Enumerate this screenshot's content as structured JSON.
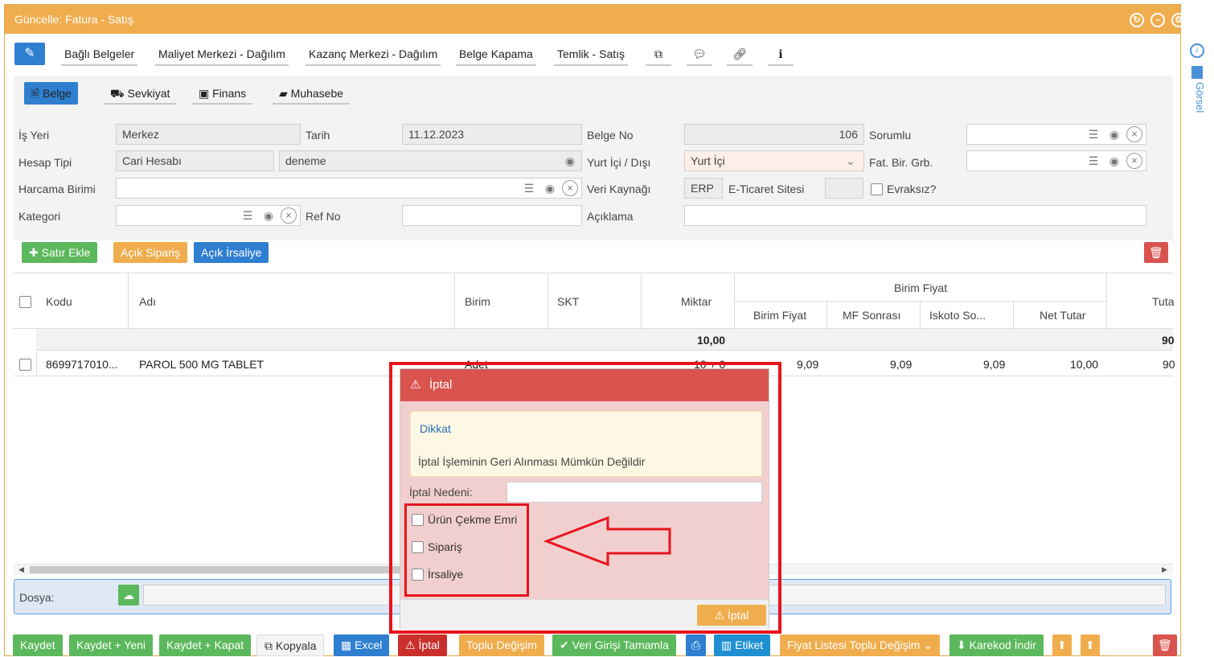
{
  "window": {
    "title": "Güncelle: Fatura - Satış"
  },
  "toolbar": {
    "items": [
      "Bağlı Belgeler",
      "Maliyet Merkezi - Dağılım",
      "Kazanç Merkezi - Dağılım",
      "Belge Kapama",
      "Temlik - Satış"
    ],
    "icons": [
      "edit-icon",
      "copy-icon",
      "comment-icon",
      "link-icon",
      "info-icon"
    ]
  },
  "tabs": [
    {
      "label": "Belge",
      "active": true,
      "icon": "document-icon"
    },
    {
      "label": "Sevkiyat",
      "icon": "truck-icon"
    },
    {
      "label": "Finans",
      "icon": "money-icon"
    },
    {
      "label": "Muhasebe",
      "icon": "book-icon"
    }
  ],
  "form": {
    "is_yeri_label": "İş Yeri",
    "is_yeri_value": "Merkez",
    "tarih_label": "Tarih",
    "tarih_value": "11.12.2023",
    "belge_no_label": "Belge No",
    "belge_no_value": "106",
    "sorumlu_label": "Sorumlu",
    "hesap_tipi_label": "Hesap Tipi",
    "hesap_tipi_value": "Cari Hesabı",
    "hesap_value": "deneme",
    "yurt_label": "Yurt İçi / Dışı",
    "yurt_value": "Yurt İçi",
    "fat_label": "Fat. Bir. Grb.",
    "harcama_label": "Harcama Birimi",
    "veri_kaynagi_label": "Veri Kaynağı",
    "veri_kaynagi_value": "ERP",
    "eticaret_label": "E-Ticaret Sitesi",
    "evraksiz_label": "Evraksız?",
    "kategori_label": "Kategori",
    "ref_no_label": "Ref No",
    "aciklama_label": "Açıklama"
  },
  "grid_actions": {
    "add_row": "Satır Ekle",
    "open_order": "Açık Sipariş",
    "open_waybill": "Açık İrsaliye"
  },
  "grid": {
    "headers": {
      "kodu": "Kodu",
      "adi": "Adı",
      "birim": "Birim",
      "skt": "SKT",
      "miktar": "Miktar",
      "birim_fiyat_group": "Birim Fiyat",
      "birim_fiyat": "Birim Fiyat",
      "mf_sonrasi": "MF Sonrası",
      "iskoto": "Iskoto So...",
      "net_tutar": "Net Tutar",
      "tutar": "Tuta"
    },
    "summary": {
      "miktar": "10,00",
      "tutar": "90"
    },
    "rows": [
      {
        "kodu": "8699717010...",
        "adi": "PAROL 500 MG TABLET",
        "birim": "Adet",
        "miktar": "10 + 0",
        "birim_fiyat": "9,09",
        "mf_sonrasi": "9,09",
        "iskoto": "9,09",
        "net_tutar": "10,00",
        "tutar": "90"
      }
    ]
  },
  "dosya": {
    "label": "Dosya:"
  },
  "footer": {
    "buttons": [
      "Kaydet",
      "Kaydet + Yeni",
      "Kaydet + Kapat",
      "Kopyala",
      "Excel",
      "İptal",
      "Toplu Değişim",
      "Veri Girişi Tamamla",
      "Etiket",
      "Fiyat Listesi Toplu Değişim",
      "Karekod İndir"
    ]
  },
  "modal": {
    "title": "İptal",
    "alert_title": "Dikkat",
    "alert_text": "İptal İşleminin Geri Alınması Mümkün Değildir",
    "reason_label": "İptal Nedeni:",
    "options": [
      "Ürün Çekme Emri",
      "Sipariş",
      "İrsaliye"
    ],
    "confirm": "İptal"
  },
  "side_panel": {
    "label": "Görsel"
  },
  "colors": {
    "title_bar": "#f0ad4e",
    "primary": "#2f7fd1",
    "success": "#5cb85c",
    "danger": "#d9534f",
    "annotation": "#e8141c"
  }
}
